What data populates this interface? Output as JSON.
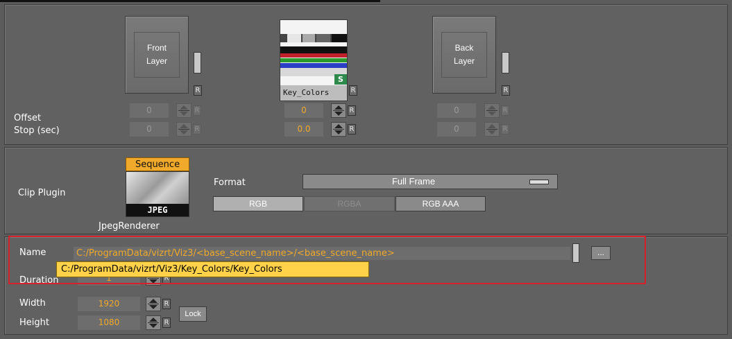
{
  "layers": {
    "front": {
      "line1": "Front",
      "line2": "Layer",
      "r": "R"
    },
    "middle": {
      "caption": "Key_Colors",
      "r": "R",
      "badge": "S"
    },
    "back": {
      "line1": "Back",
      "line2": "Layer",
      "r": "R"
    }
  },
  "offset": {
    "label": "Offset",
    "front": "0",
    "middle": "0",
    "back": "0"
  },
  "stop": {
    "label": "Stop (sec)",
    "front": "0",
    "middle": "0.0",
    "back": "0"
  },
  "r_label": "R",
  "clip": {
    "label": "Clip Plugin",
    "badge": "Sequence",
    "thumb_text": "JPEG",
    "renderer": "JpegRenderer",
    "format_label": "Format",
    "format_value": "Full Frame",
    "color_buttons": [
      "RGB",
      "RGBA",
      "RGB AAA"
    ]
  },
  "file": {
    "name_label": "Name",
    "name_value": "C:/ProgramData/vizrt/Viz3/<base_scene_name>/<base_scene_name>",
    "browse": "...",
    "tooltip": "C:/ProgramData/vizrt/Viz3/Key_Colors/Key_Colors",
    "duration_label": "Duration",
    "duration_value": "1",
    "width_label": "Width",
    "width_value": "1920",
    "height_label": "Height",
    "height_value": "1080",
    "lock": "Lock"
  },
  "colors": {
    "accent": "#f0a92a",
    "tooltip_bg": "#ffd24a",
    "highlight": "#d6212a"
  }
}
